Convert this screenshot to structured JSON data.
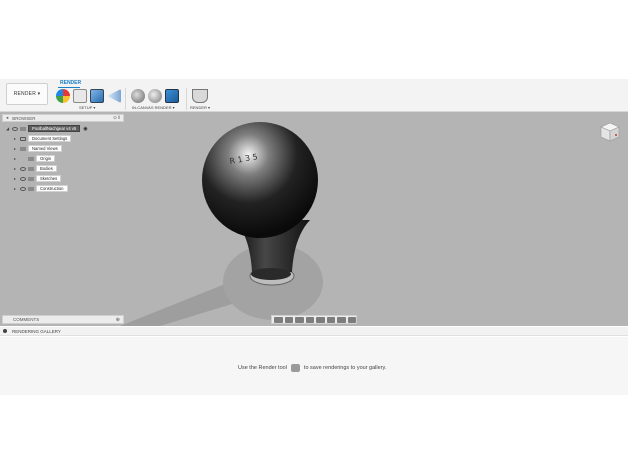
{
  "ribbon": {
    "workspace_button": "RENDER ▾",
    "active_tab": "RENDER",
    "groups": {
      "setup": "SETUP ▾",
      "in_canvas": "IN-CANVAS RENDER ▾",
      "render": "RENDER ▾"
    }
  },
  "browser": {
    "header": "BROWSER",
    "root": "PoolballNachgear v4 v5",
    "items": [
      {
        "label": "Document Settings"
      },
      {
        "label": "Named Views"
      },
      {
        "label": "Origin"
      },
      {
        "label": "Bodies"
      },
      {
        "label": "Sketches"
      },
      {
        "label": "Construction"
      }
    ]
  },
  "comments": {
    "header": "COMMENTS"
  },
  "gallery": {
    "header": "RENDERING GALLERY",
    "message_before": "Use the Render tool",
    "message_after": "to save renderings to your gallery."
  },
  "colors": {
    "accent": "#1a7fc6",
    "canvas": "#b4b4b4"
  }
}
